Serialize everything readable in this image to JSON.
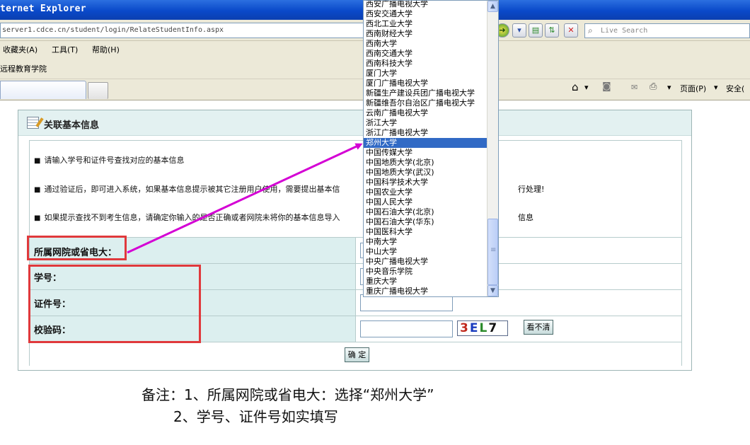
{
  "browser": {
    "title": "ternet Explorer",
    "url": "server1.cdce.cn/student/login/RelateStudentInfo.aspx",
    "search_placeholder": "Live Search",
    "menu": [
      "收藏夹(A)",
      "工具(T)",
      "帮助(H)"
    ],
    "link": "远程教育学院",
    "page_menu": "页面(P)",
    "safety_menu": "安全("
  },
  "panel": {
    "title": "关联基本信息",
    "notes": [
      "请输入学号和证件号查找对应的基本信息",
      "通过验证后，即可进入系统，如果基本信息提示被其它注册用户使用，需要提出基本信",
      "如果提示查找不到考生信息，请确定你输入的是否正确或者网院未将你的基本信息导入"
    ],
    "notes_tail": [
      "行处理!",
      "信息"
    ],
    "fields": {
      "college_label": "所属网院或省电大：",
      "student_id_label": "学号：",
      "id_number_label": "证件号：",
      "captcha_label": "校验码："
    },
    "captcha_text": [
      "3",
      "E",
      "L",
      "7"
    ],
    "refresh_captcha": "看不清",
    "submit": "确 定"
  },
  "dropdown": {
    "items": [
      "西安广播电视大学",
      "西安交通大学",
      "西北工业大学",
      "西南财经大学",
      "西南大学",
      "西南交通大学",
      "西南科技大学",
      "厦门大学",
      "厦门广播电视大学",
      "新疆生产建设兵团广播电视大学",
      "新疆维吾尔自治区广播电视大学",
      "云南广播电视大学",
      "浙江大学",
      "浙江广播电视大学",
      "郑州大学",
      "中国传媒大学",
      "中国地质大学(北京)",
      "中国地质大学(武汉)",
      "中国科学技术大学",
      "中国农业大学",
      "中国人民大学",
      "中国石油大学(北京)",
      "中国石油大学(华东)",
      "中国医科大学",
      "中南大学",
      "中山大学",
      "中央广播电视大学",
      "中央音乐学院",
      "重庆大学",
      "重庆广播电视大学"
    ],
    "selected_index": 14
  },
  "remark": {
    "line1": "备注：1、所属网院或省电大：选择“郑州大学”",
    "line2": "2、学号、证件号如实填写"
  },
  "colors": {
    "highlight": "#316ac5",
    "annotation_red": "#e0393c",
    "arrow_magenta": "#d400d4"
  }
}
